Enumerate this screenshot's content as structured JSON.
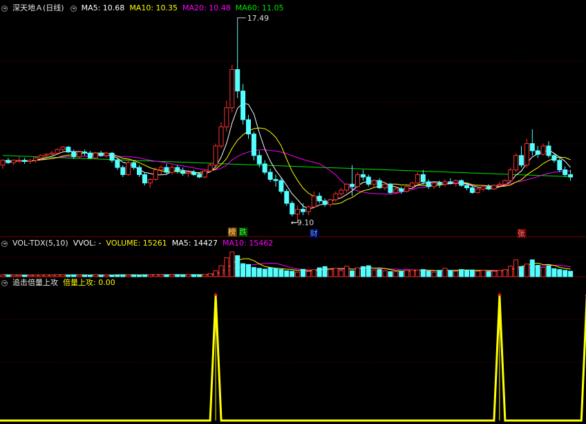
{
  "main_header": {
    "title": "深天地Ａ(日线)",
    "ma5": "MA5: 10.68",
    "ma10": "MA10: 10.35",
    "ma20": "MA20: 10.48",
    "ma60": "MA60: 11.05"
  },
  "vol_header": {
    "title": "VOL-TDX(5,10)",
    "vvol": "VVOL: -",
    "volume": "VOLUME: 15261",
    "ma5": "MA5: 14427",
    "ma10": "MA10: 15462"
  },
  "sig_header": {
    "title": "追击倍量上攻",
    "value": "倍量上攻: 0.00"
  },
  "colors": {
    "up": "#ff3232",
    "down": "#54ffff",
    "ma5": "#ffffff",
    "ma10": "#ffff00",
    "ma20": "#ff00ff",
    "ma60": "#00e600",
    "signal": "#ffff00",
    "grid": "#7a0000"
  },
  "markers": {
    "high_label": "17.49",
    "low_label": "9.10",
    "tag_bang": "榜",
    "tag_die": "跌",
    "tag_cai": "财",
    "tag_zhang": "张"
  },
  "chart_data": {
    "type": "candlestick",
    "price_range": [
      9.1,
      17.49
    ],
    "candles": [
      [
        11.5,
        11.75,
        11.35,
        11.7
      ],
      [
        11.7,
        11.8,
        11.55,
        11.6
      ],
      [
        11.6,
        11.75,
        11.5,
        11.7
      ],
      [
        11.7,
        11.85,
        11.6,
        11.7
      ],
      [
        11.7,
        11.8,
        11.55,
        11.65
      ],
      [
        11.65,
        11.75,
        11.55,
        11.7
      ],
      [
        11.7,
        11.85,
        11.6,
        11.8
      ],
      [
        11.8,
        11.95,
        11.7,
        11.9
      ],
      [
        11.9,
        12.0,
        11.8,
        11.95
      ],
      [
        11.95,
        12.1,
        11.85,
        12.0
      ],
      [
        12.0,
        12.2,
        11.95,
        12.15
      ],
      [
        12.15,
        12.3,
        12.05,
        12.25
      ],
      [
        12.25,
        12.3,
        12.0,
        12.05
      ],
      [
        12.05,
        12.15,
        11.75,
        11.85
      ],
      [
        11.85,
        12.1,
        11.8,
        12.05
      ],
      [
        12.05,
        12.15,
        11.9,
        12.0
      ],
      [
        12.0,
        12.1,
        11.75,
        11.8
      ],
      [
        11.8,
        12.05,
        11.75,
        12.0
      ],
      [
        12.0,
        12.1,
        11.85,
        11.9
      ],
      [
        11.9,
        12.05,
        11.8,
        12.0
      ],
      [
        12.0,
        12.05,
        11.6,
        11.7
      ],
      [
        11.7,
        11.8,
        11.3,
        11.4
      ],
      [
        11.4,
        11.5,
        11.0,
        11.1
      ],
      [
        11.1,
        11.7,
        11.05,
        11.6
      ],
      [
        11.6,
        11.7,
        11.3,
        11.4
      ],
      [
        11.4,
        11.5,
        11.0,
        11.1
      ],
      [
        11.1,
        11.2,
        10.65,
        10.75
      ],
      [
        10.75,
        10.95,
        10.55,
        10.9
      ],
      [
        10.9,
        11.4,
        10.85,
        11.3
      ],
      [
        11.3,
        11.5,
        11.1,
        11.4
      ],
      [
        11.4,
        11.55,
        11.1,
        11.2
      ],
      [
        11.2,
        11.5,
        11.1,
        11.4
      ],
      [
        11.4,
        11.5,
        11.15,
        11.25
      ],
      [
        11.25,
        11.4,
        11.05,
        11.15
      ],
      [
        11.15,
        11.3,
        11.0,
        11.2
      ],
      [
        11.2,
        11.3,
        11.05,
        11.1
      ],
      [
        11.1,
        11.2,
        10.95,
        11.0
      ],
      [
        11.0,
        11.3,
        10.95,
        11.25
      ],
      [
        11.25,
        11.6,
        11.2,
        11.5
      ],
      [
        11.5,
        12.4,
        11.45,
        12.3
      ],
      [
        12.3,
        13.3,
        12.2,
        13.1
      ],
      [
        13.1,
        14.2,
        12.9,
        13.9
      ],
      [
        13.9,
        15.7,
        13.7,
        15.5
      ],
      [
        15.5,
        17.49,
        14.3,
        14.6
      ],
      [
        14.6,
        14.9,
        13.2,
        13.4
      ],
      [
        13.4,
        13.6,
        12.6,
        12.8
      ],
      [
        12.8,
        12.9,
        11.7,
        11.9
      ],
      [
        11.9,
        12.1,
        11.4,
        11.55
      ],
      [
        11.55,
        11.7,
        11.1,
        11.2
      ],
      [
        11.2,
        11.35,
        10.8,
        10.9
      ],
      [
        10.9,
        11.1,
        10.6,
        10.85
      ],
      [
        10.85,
        11.0,
        10.3,
        10.4
      ],
      [
        10.4,
        10.5,
        9.8,
        9.9
      ],
      [
        9.9,
        10.0,
        9.35,
        9.45
      ],
      [
        9.45,
        9.8,
        9.1,
        9.65
      ],
      [
        9.65,
        9.9,
        9.4,
        9.55
      ],
      [
        9.55,
        9.8,
        9.4,
        9.75
      ],
      [
        9.75,
        10.4,
        9.7,
        10.2
      ],
      [
        10.2,
        10.35,
        9.9,
        10.0
      ],
      [
        10.0,
        10.1,
        9.75,
        9.85
      ],
      [
        9.85,
        10.1,
        9.75,
        10.05
      ],
      [
        10.05,
        10.4,
        9.95,
        10.3
      ],
      [
        10.3,
        10.55,
        10.2,
        10.45
      ],
      [
        10.45,
        10.75,
        10.35,
        10.7
      ],
      [
        10.7,
        11.5,
        10.2,
        10.6
      ],
      [
        10.6,
        11.2,
        10.55,
        11.1
      ],
      [
        11.1,
        11.3,
        10.85,
        11.0
      ],
      [
        11.0,
        11.1,
        10.6,
        10.7
      ],
      [
        10.7,
        10.9,
        10.55,
        10.85
      ],
      [
        10.85,
        10.95,
        10.5,
        10.55
      ],
      [
        10.55,
        10.8,
        10.45,
        10.7
      ],
      [
        10.7,
        10.75,
        10.3,
        10.35
      ],
      [
        10.35,
        10.6,
        10.3,
        10.5
      ],
      [
        10.5,
        10.6,
        10.3,
        10.4
      ],
      [
        10.4,
        10.65,
        10.35,
        10.6
      ],
      [
        10.6,
        10.8,
        10.5,
        10.75
      ],
      [
        10.75,
        11.2,
        10.7,
        11.1
      ],
      [
        11.1,
        11.3,
        10.7,
        10.8
      ],
      [
        10.8,
        10.9,
        10.5,
        10.6
      ],
      [
        10.6,
        10.8,
        10.5,
        10.75
      ],
      [
        10.75,
        10.85,
        10.55,
        10.7
      ],
      [
        10.7,
        10.9,
        10.6,
        10.8
      ],
      [
        10.8,
        10.95,
        10.7,
        10.75
      ],
      [
        10.75,
        10.9,
        10.6,
        10.85
      ],
      [
        10.85,
        10.9,
        10.6,
        10.65
      ],
      [
        10.65,
        10.75,
        10.45,
        10.55
      ],
      [
        10.55,
        10.65,
        10.3,
        10.35
      ],
      [
        10.35,
        10.6,
        10.3,
        10.5
      ],
      [
        10.5,
        10.65,
        10.4,
        10.6
      ],
      [
        10.6,
        10.7,
        10.45,
        10.5
      ],
      [
        10.5,
        10.7,
        10.45,
        10.65
      ],
      [
        10.65,
        10.8,
        10.55,
        10.7
      ],
      [
        10.7,
        10.9,
        10.65,
        10.85
      ],
      [
        10.85,
        11.4,
        10.8,
        11.3
      ],
      [
        11.3,
        12.0,
        11.2,
        11.9
      ],
      [
        11.9,
        12.3,
        11.4,
        11.5
      ],
      [
        11.5,
        12.6,
        11.4,
        12.4
      ],
      [
        12.4,
        13.0,
        11.9,
        12.1
      ],
      [
        12.1,
        12.3,
        11.8,
        11.95
      ],
      [
        11.95,
        12.4,
        11.9,
        12.3
      ],
      [
        12.3,
        12.5,
        11.8,
        11.9
      ],
      [
        11.9,
        12.0,
        11.6,
        11.7
      ],
      [
        11.7,
        11.8,
        11.2,
        11.3
      ],
      [
        11.3,
        11.45,
        11.0,
        11.1
      ],
      [
        11.1,
        11.3,
        10.85,
        11.0
      ]
    ],
    "volume": [
      9,
      8,
      8,
      7,
      8,
      7,
      8,
      8,
      9,
      8,
      9,
      9,
      8,
      9,
      8,
      8,
      8,
      9,
      8,
      8,
      8,
      9,
      9,
      8,
      9,
      8,
      9,
      9,
      10,
      9,
      9,
      9,
      10,
      9,
      10,
      10,
      9,
      10,
      14,
      28,
      52,
      90,
      118,
      100,
      62,
      58,
      44,
      40,
      36,
      42,
      40,
      34,
      28,
      26,
      22,
      35,
      25,
      34,
      42,
      48,
      34,
      40,
      28,
      50,
      28,
      42,
      48,
      52,
      32,
      34,
      28,
      24,
      24,
      26,
      30,
      32,
      32,
      34,
      26,
      22,
      30,
      40,
      30,
      26,
      34,
      30,
      32,
      26,
      30,
      24,
      26,
      30,
      34,
      50,
      80,
      48,
      60,
      80,
      54,
      44,
      52,
      38,
      34,
      30,
      26
    ],
    "signal_spikes": [
      39,
      91,
      107
    ],
    "signal_max": 1
  }
}
